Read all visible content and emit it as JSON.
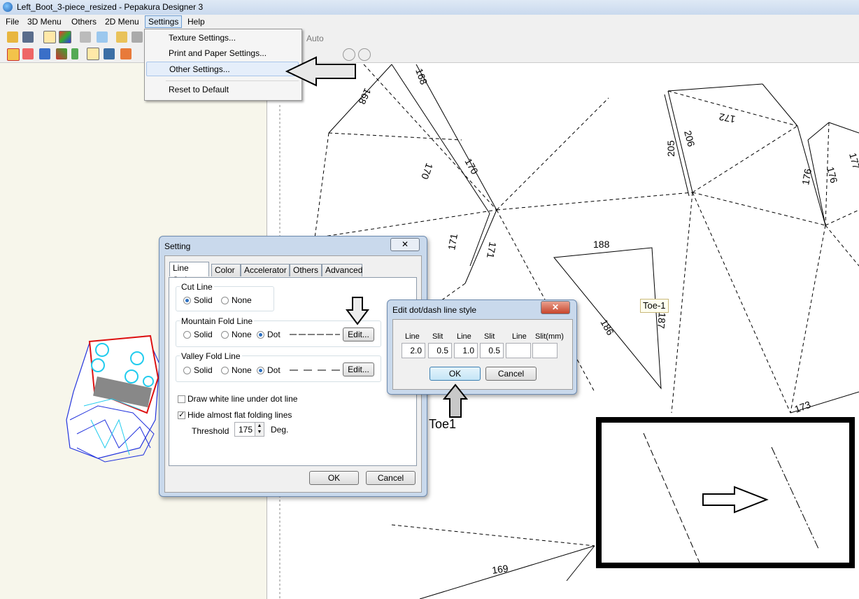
{
  "window": {
    "title": "Left_Boot_3-piece_resized - Pepakura Designer 3"
  },
  "menubar": {
    "items": [
      "File",
      "3D Menu",
      "Others",
      "2D Menu",
      "Settings",
      "Help"
    ]
  },
  "toolbar": {
    "auto_label": "Auto"
  },
  "settings_menu": {
    "items": [
      "Texture Settings...",
      "Print and Paper Settings...",
      "Other Settings...",
      "Reset to Default"
    ],
    "highlighted": "Other Settings..."
  },
  "unfold_view": {
    "part_numbers": [
      "168",
      "168",
      "170",
      "170",
      "171",
      "171",
      "188",
      "186",
      "172",
      "205",
      "206",
      "176",
      "176",
      "177",
      "173",
      "169",
      "187"
    ],
    "part_label": "Toe-1"
  },
  "setting_dialog": {
    "title": "Setting",
    "close": "✕",
    "tabs": [
      "Line Style",
      "Color",
      "Accelerator",
      "Others",
      "Advanced"
    ],
    "selected_tab": "Line Style",
    "cut_line": {
      "label": "Cut Line",
      "options": [
        "Solid",
        "None"
      ],
      "selected": "Solid"
    },
    "mountain": {
      "label": "Mountain Fold Line",
      "options": [
        "Solid",
        "None",
        "Dot"
      ],
      "selected": "Dot",
      "edit": "Edit..."
    },
    "valley": {
      "label": "Valley Fold Line",
      "options": [
        "Solid",
        "None",
        "Dot"
      ],
      "selected": "Dot",
      "edit": "Edit..."
    },
    "draw_white": {
      "label": "Draw white line under dot line",
      "checked": false
    },
    "hide_flat": {
      "label": "Hide almost flat folding lines",
      "checked": true
    },
    "threshold": {
      "label": "Threshold",
      "value": "175",
      "unit": "Deg."
    },
    "ok": "OK",
    "cancel": "Cancel"
  },
  "dash_dialog": {
    "title": "Edit dot/dash line style",
    "close": "✕",
    "columns": [
      "Line",
      "Slit",
      "Line",
      "Slit",
      "Line",
      "Slit(mm)"
    ],
    "values": [
      "2.0",
      "0.5",
      "1.0",
      "0.5",
      "",
      ""
    ],
    "ok": "OK",
    "cancel": "Cancel"
  },
  "annotation": {
    "toe_label": "Toe1"
  }
}
